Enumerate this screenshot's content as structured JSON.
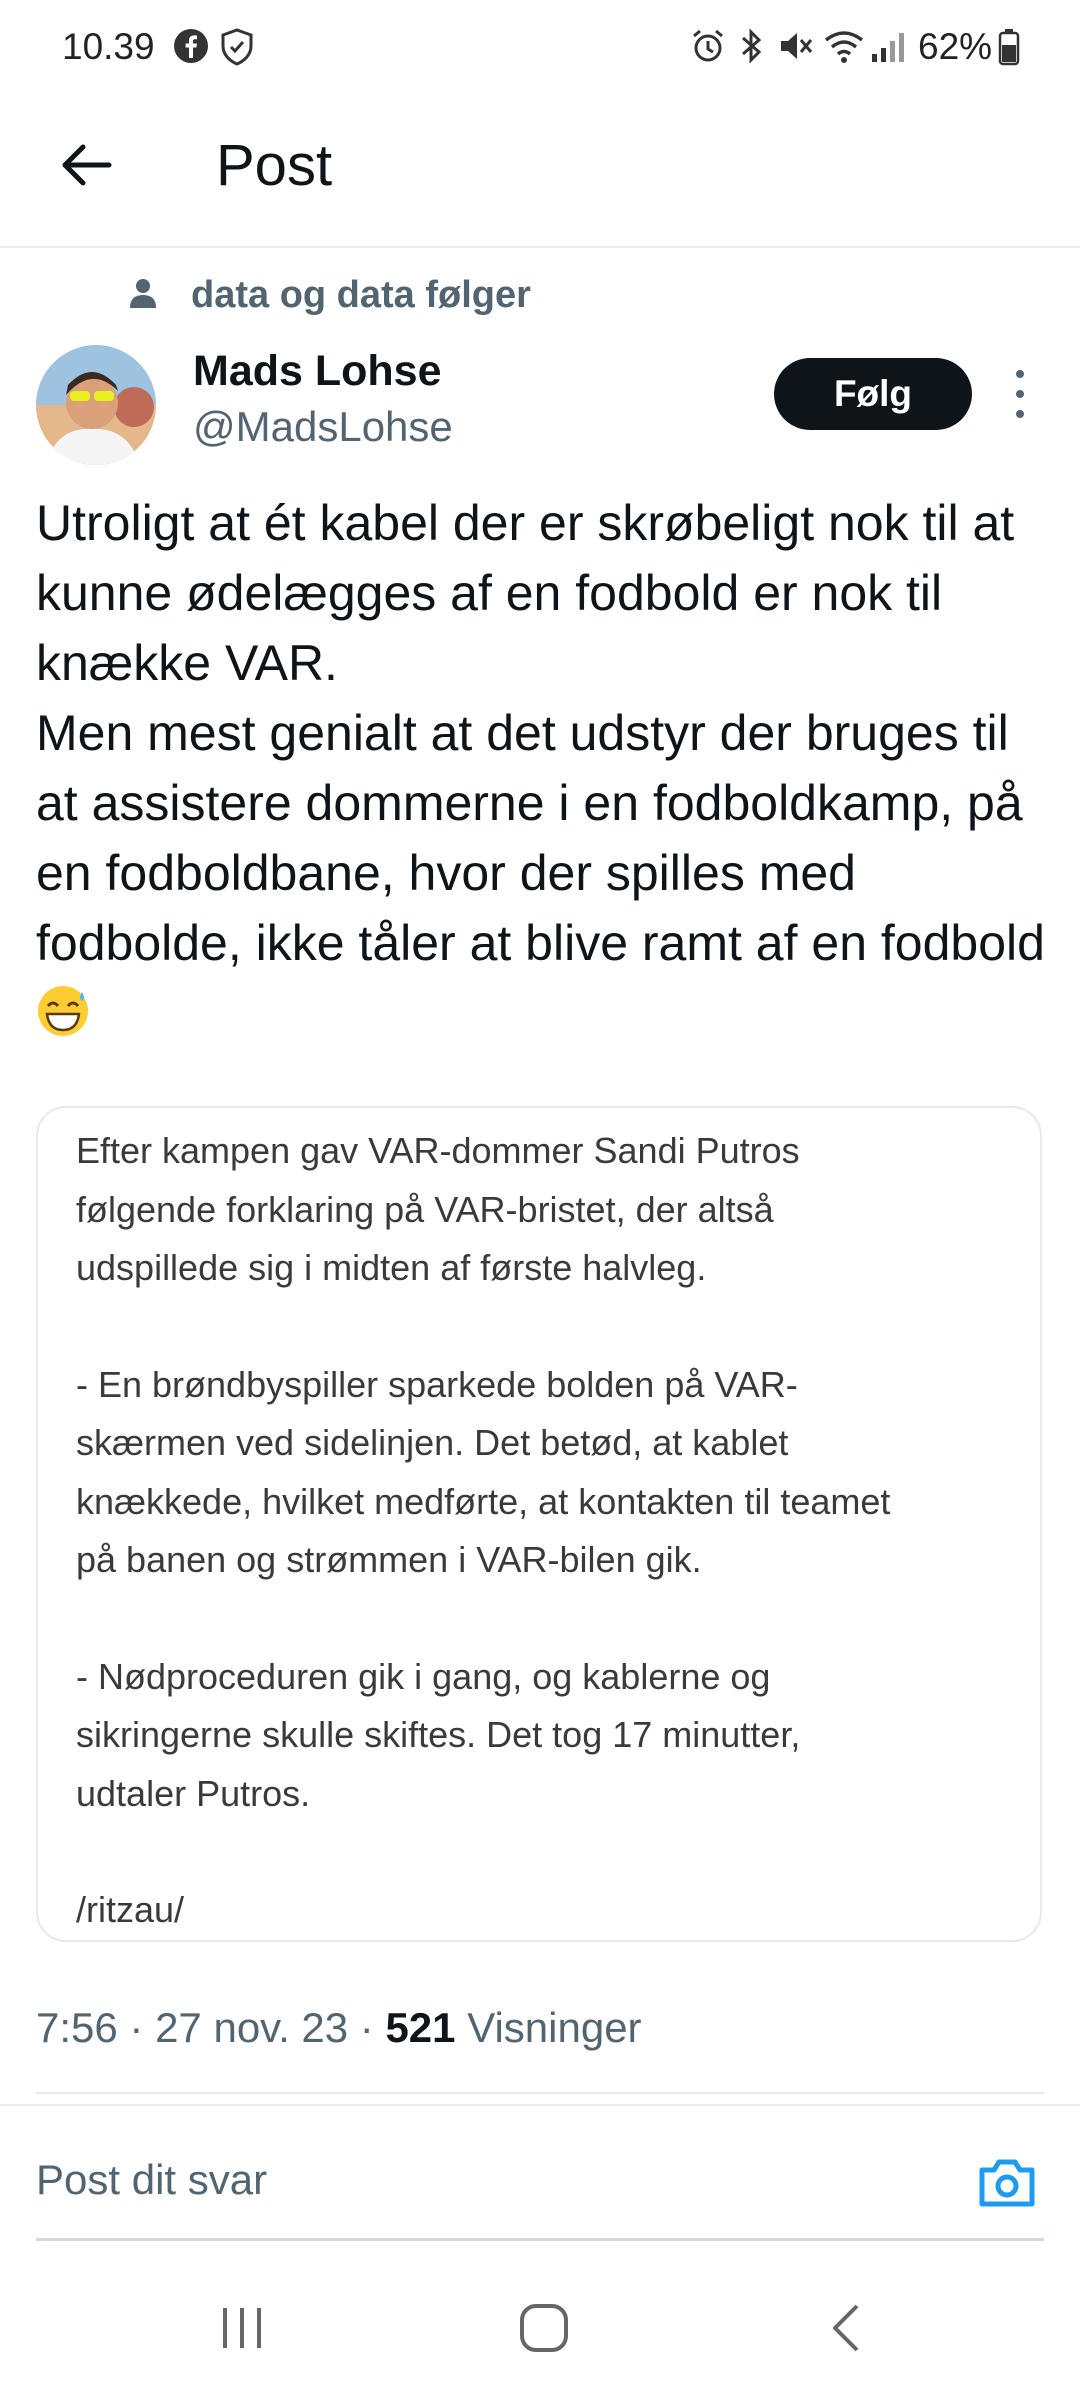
{
  "status_bar": {
    "time": "10.39",
    "battery": "62%",
    "icons": [
      "facebook-icon",
      "shield-icon",
      "alarm-icon",
      "bluetooth-icon",
      "mute-icon",
      "wifi-icon",
      "signal-icon",
      "battery-icon"
    ]
  },
  "header": {
    "title": "Post",
    "back_icon": "arrow-left-icon"
  },
  "context": {
    "text": "data og data følger",
    "icon": "person-icon"
  },
  "author": {
    "name": "Mads Lohse",
    "handle": "@MadsLohse",
    "follow_label": "Følg",
    "more_icon": "more-vertical-icon"
  },
  "post": {
    "paragraph1": "Utroligt at ét kabel der er skrøbeligt nok til at kunne ødelægges af en fodbold er nok til knække VAR.",
    "paragraph2": "Men mest genialt at det udstyr der bruges til at assistere dommerne i en fodboldkamp, på en fodboldbane, hvor der spilles med fodbolde, ikke tåler at blive ramt af en fodbold",
    "emoji": "grinning-sweat-emoji"
  },
  "quote_image": {
    "paragraphs": [
      "Efter kampen gav VAR-dommer Sandi Putros\nfølgende forklaring på VAR-bristet, der altså\nudspillede sig i midten af første halvleg.",
      "- En brøndbyspiller sparkede bolden på VAR-\nskærmen ved sidelinjen. Det betød, at kablet\nknækkede, hvilket medførte, at kontakten til teamet\npå banen og strømmen i VAR-bilen gik.",
      "- Nødproceduren gik i gang, og kablerne og\nsikringerne skulle skiftes. Det tog 17 minutter,\nudtaler Putros.",
      "/ritzau/"
    ]
  },
  "meta": {
    "time": "7:56",
    "separator": " · ",
    "date": "27 nov. 23",
    "views_count": "521",
    "views_label": " Visninger"
  },
  "reply": {
    "placeholder": "Post dit svar",
    "camera_icon": "camera-icon"
  },
  "nav": {
    "icons": [
      "recents-icon",
      "home-icon",
      "back-icon"
    ]
  },
  "colors": {
    "text": "#0f1419",
    "secondary": "#536471",
    "accent": "#1d9bf0",
    "border": "#e7e9ea"
  }
}
